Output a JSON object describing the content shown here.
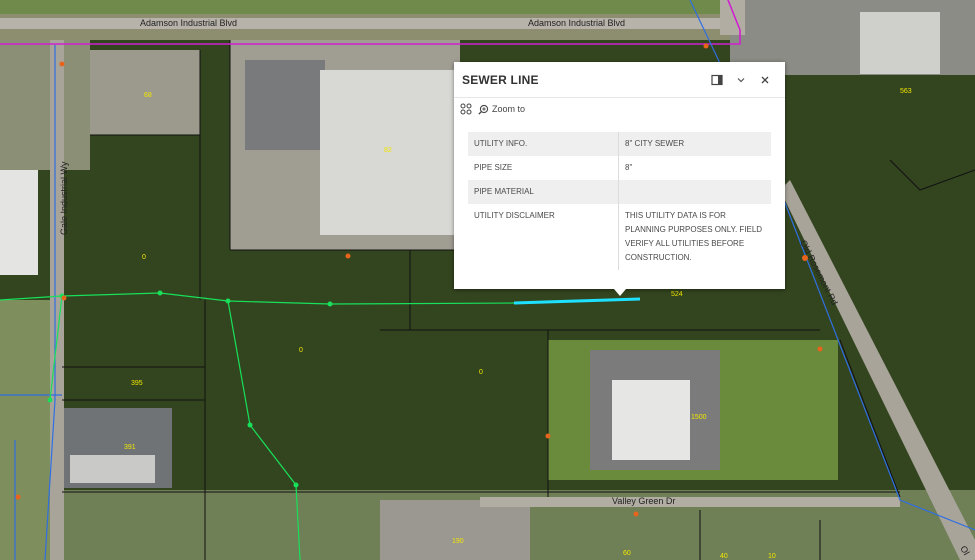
{
  "map": {
    "roads": {
      "north_left": "Adamson Industrial Blvd",
      "north_right": "Adamson Industrial Blvd",
      "west": "Gale Industrial Wy",
      "east": "Old Rosemont Rd",
      "south": "Valley Green Dr",
      "southeast": "Ol"
    },
    "parcel_numbers": [
      "68",
      "82",
      "563",
      "0",
      "0",
      "0",
      "524",
      "395",
      "391",
      "1500",
      "190",
      "60",
      "40",
      "10"
    ],
    "colors": {
      "sewer_line": "#18e05a",
      "selected_sewer": "#1ee0ff",
      "power_line": "#d020d0",
      "water_line": "#2f6fe0",
      "parcel_boundary": "#111111",
      "parcel_label": "#f2e600",
      "hydrant": "#e8641c"
    }
  },
  "popup": {
    "title": "SEWER LINE",
    "dock_icon": "dock-icon",
    "collapse_icon": "chevron-down-icon",
    "close_icon": "close-icon",
    "tools_icon": "feature-menu-icon",
    "zoom_icon": "zoom-in-icon",
    "zoom_label": "Zoom to",
    "attributes": [
      {
        "key": "UTILITY INFO.",
        "value": "8\" CITY SEWER"
      },
      {
        "key": "PIPE SIZE",
        "value": "8\""
      },
      {
        "key": "PIPE MATERIAL",
        "value": ""
      },
      {
        "key": "UTILITY DISCLAIMER",
        "value": "THIS UTILITY DATA IS FOR PLANNING PURPOSES ONLY. FIELD VERIFY ALL UTILITIES BEFORE CONSTRUCTION."
      }
    ]
  }
}
